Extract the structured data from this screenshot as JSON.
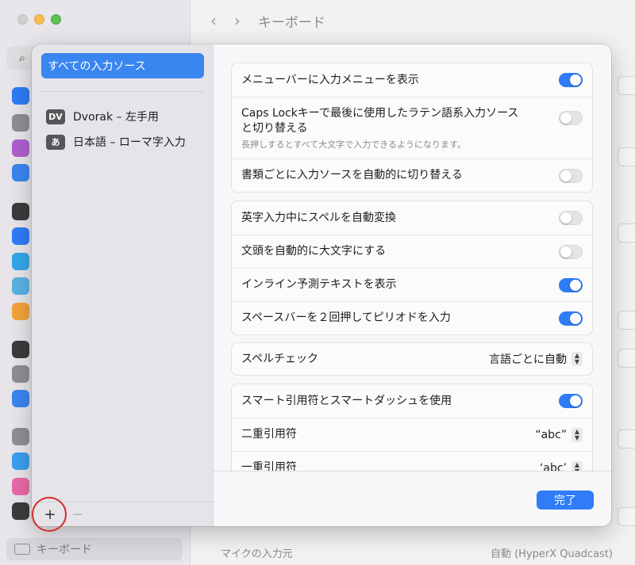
{
  "window": {
    "title": "キーボード",
    "back_glyph": "‹",
    "forward_glyph": "›"
  },
  "bg_sidebar": {
    "search_icon": "⌕",
    "selected_label": "キーボード"
  },
  "bg_main": {
    "mic_label": "マイクの入力元",
    "mic_value": "自動 (HyperX Quadcast)"
  },
  "sources": {
    "all_label": "すべての入力ソース",
    "items": [
      {
        "badge": "DV",
        "label": "Dvorak – 左手用"
      },
      {
        "badge": "あ",
        "label": "日本語 – ローマ字入力"
      }
    ],
    "add_label": "+",
    "remove_label": "−"
  },
  "settings": {
    "group1": {
      "show_input_menu": {
        "label": "メニューバーに入力メニューを表示",
        "on": true
      },
      "caps_lock": {
        "label_line1": "Caps Lockキーで最後に使用したラテン語系入力ソース",
        "label_line2": "と切り替える",
        "sub": "長押しするとすべて大文字で入力できるようになります。",
        "on": false
      },
      "auto_switch": {
        "label": "書類ごとに入力ソースを自動的に切り替える",
        "on": false
      }
    },
    "group2": {
      "autocorrect": {
        "label": "英字入力中にスペルを自動変換",
        "on": false
      },
      "capitalize": {
        "label": "文頭を自動的に大文字にする",
        "on": false
      },
      "inline_predictive": {
        "label": "インライン予測テキストを表示",
        "on": true
      },
      "double_space": {
        "label": "スペースバーを２回押してピリオドを入力",
        "on": true
      }
    },
    "spellcheck": {
      "label": "スペルチェック",
      "value": "言語ごとに自動"
    },
    "group3": {
      "smart_quotes": {
        "label": "スマート引用符とスマートダッシュを使用",
        "on": true
      },
      "double_quote": {
        "label": "二重引用符",
        "value": "“abc”"
      },
      "single_quote": {
        "label": "一重引用符",
        "value": "‘abc’"
      }
    }
  },
  "footer": {
    "done_label": "完了"
  },
  "colors": {
    "accent": "#2f7cf6",
    "selection": "#3a86f0",
    "annotation_circle": "#d82c2c"
  }
}
